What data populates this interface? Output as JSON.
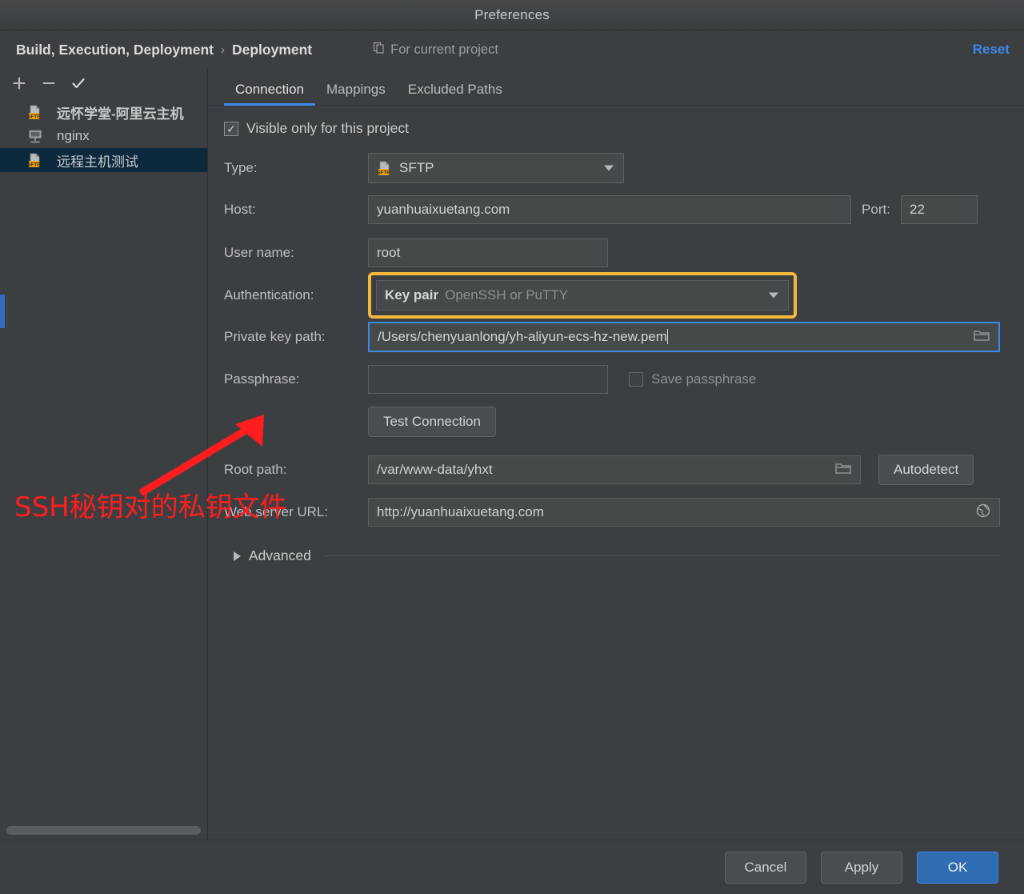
{
  "window": {
    "title": "Preferences"
  },
  "header": {
    "breadcrumb": [
      "Build, Execution, Deployment",
      "Deployment"
    ],
    "separator": "›",
    "scope_label": "For current project",
    "scope_icon": "copy-icon",
    "reset_label": "Reset",
    "reset_color": "#3d87e8"
  },
  "sidebar": {
    "toolbar": [
      {
        "name": "add-server-button",
        "glyph": "+"
      },
      {
        "name": "remove-server-button",
        "glyph": "−"
      },
      {
        "name": "set-default-server-button",
        "glyph": "✓"
      }
    ],
    "items": [
      {
        "label": "远怀学堂-阿里云主机",
        "icon": "sftp-icon",
        "selected": false,
        "bold": true
      },
      {
        "label": "nginx",
        "icon": "server-icon",
        "selected": false,
        "bold": false
      },
      {
        "label": "远程主机测试",
        "icon": "sftp-icon",
        "selected": true,
        "bold": false
      }
    ]
  },
  "tabs": [
    {
      "label": "Connection",
      "active": true
    },
    {
      "label": "Mappings",
      "active": false
    },
    {
      "label": "Excluded Paths",
      "active": false
    }
  ],
  "form": {
    "visible_only": {
      "label": "Visible only for this project",
      "checked": true
    },
    "type": {
      "label": "Type:",
      "value": "SFTP",
      "icon": "sftp-icon"
    },
    "host": {
      "label": "Host:",
      "value": "yuanhuaixuetang.com"
    },
    "port": {
      "label": "Port:",
      "value": "22"
    },
    "user_name": {
      "label": "User name:",
      "value": "root"
    },
    "authentication": {
      "label": "Authentication:",
      "value": "Key pair",
      "value_sub": "OpenSSH or PuTTY",
      "highlight_color": "#f5b83d"
    },
    "private_key_path": {
      "label": "Private key path:",
      "value": "/Users/chenyuanlong/yh-aliyun-ecs-hz-new.pem",
      "focus_color": "#3d87e8",
      "browse_icon": "folder-icon"
    },
    "passphrase": {
      "label": "Passphrase:",
      "value": ""
    },
    "save_passphrase": {
      "label": "Save passphrase",
      "checked": false
    },
    "test_connection_label": "Test Connection",
    "root_path": {
      "label": "Root path:",
      "value": "/var/www-data/yhxt",
      "browse_icon": "folder-icon"
    },
    "autodetect_label": "Autodetect",
    "web_server_url": {
      "label": "Web server URL:",
      "value": "http://yuanhuaixuetang.com",
      "icon": "globe-icon"
    },
    "advanced_label": "Advanced"
  },
  "footer": {
    "cancel_label": "Cancel",
    "apply_label": "Apply",
    "ok_label": "OK"
  },
  "annotation": {
    "text": "SSH秘钥对的私钥文件",
    "color": "#ff1d1d",
    "arrow": "red-arrow-pointing-to-private-key-path"
  }
}
